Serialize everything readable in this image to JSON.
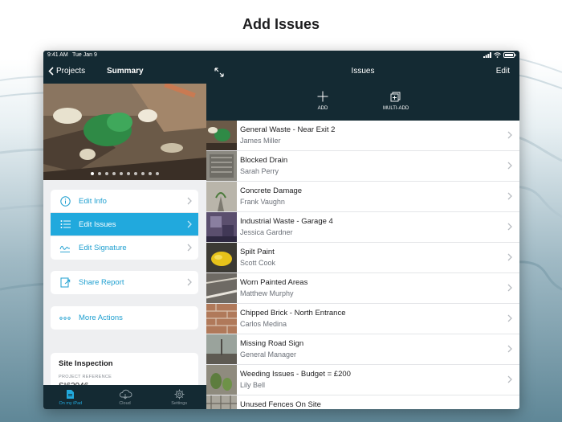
{
  "headline": "Add Issues",
  "status_bar": {
    "time": "9:41 AM",
    "date": "Tue Jan 9"
  },
  "left_pane": {
    "back_label": "Projects",
    "title": "Summary",
    "photo_dots": 10,
    "menu_group_1": [
      {
        "label": "Edit Info",
        "icon": "info-icon",
        "active": false
      },
      {
        "label": "Edit Issues",
        "icon": "list-icon",
        "active": true
      },
      {
        "label": "Edit Signature",
        "icon": "signature-icon",
        "active": false
      }
    ],
    "share_label": "Share Report",
    "more_label": "More Actions",
    "site": {
      "title": "Site Inspection",
      "ref_label": "PROJECT REFERENCE",
      "ref_value": "SI62946"
    },
    "tabs": [
      {
        "label": "On my iPad",
        "icon": "document-icon",
        "active": true
      },
      {
        "label": "Cloud",
        "icon": "cloud-icon",
        "active": false
      },
      {
        "label": "Settings",
        "icon": "gear-icon",
        "active": false
      }
    ]
  },
  "right_pane": {
    "title": "Issues",
    "edit_label": "Edit",
    "add_label": "ADD",
    "multi_add_label": "MULTI-ADD",
    "issues": [
      {
        "title": "General Waste - Near Exit 2",
        "person": "James Miller"
      },
      {
        "title": "Blocked Drain",
        "person": "Sarah Perry"
      },
      {
        "title": "Concrete Damage",
        "person": "Frank Vaughn"
      },
      {
        "title": "Industrial Waste - Garage 4",
        "person": "Jessica Gardner"
      },
      {
        "title": "Spilt Paint",
        "person": "Scott Cook"
      },
      {
        "title": "Worn Painted Areas",
        "person": "Matthew Murphy"
      },
      {
        "title": "Chipped Brick - North Entrance",
        "person": "Carlos Medina"
      },
      {
        "title": "Missing Road Sign",
        "person": "General Manager"
      },
      {
        "title": "Weeding Issues - Budget = £200",
        "person": "Lily Bell"
      },
      {
        "title": "Unused Fences On Site",
        "person": ""
      }
    ]
  },
  "colors": {
    "nav_dark": "#142a33",
    "accent": "#21a9dd",
    "link": "#1e9fd0"
  }
}
